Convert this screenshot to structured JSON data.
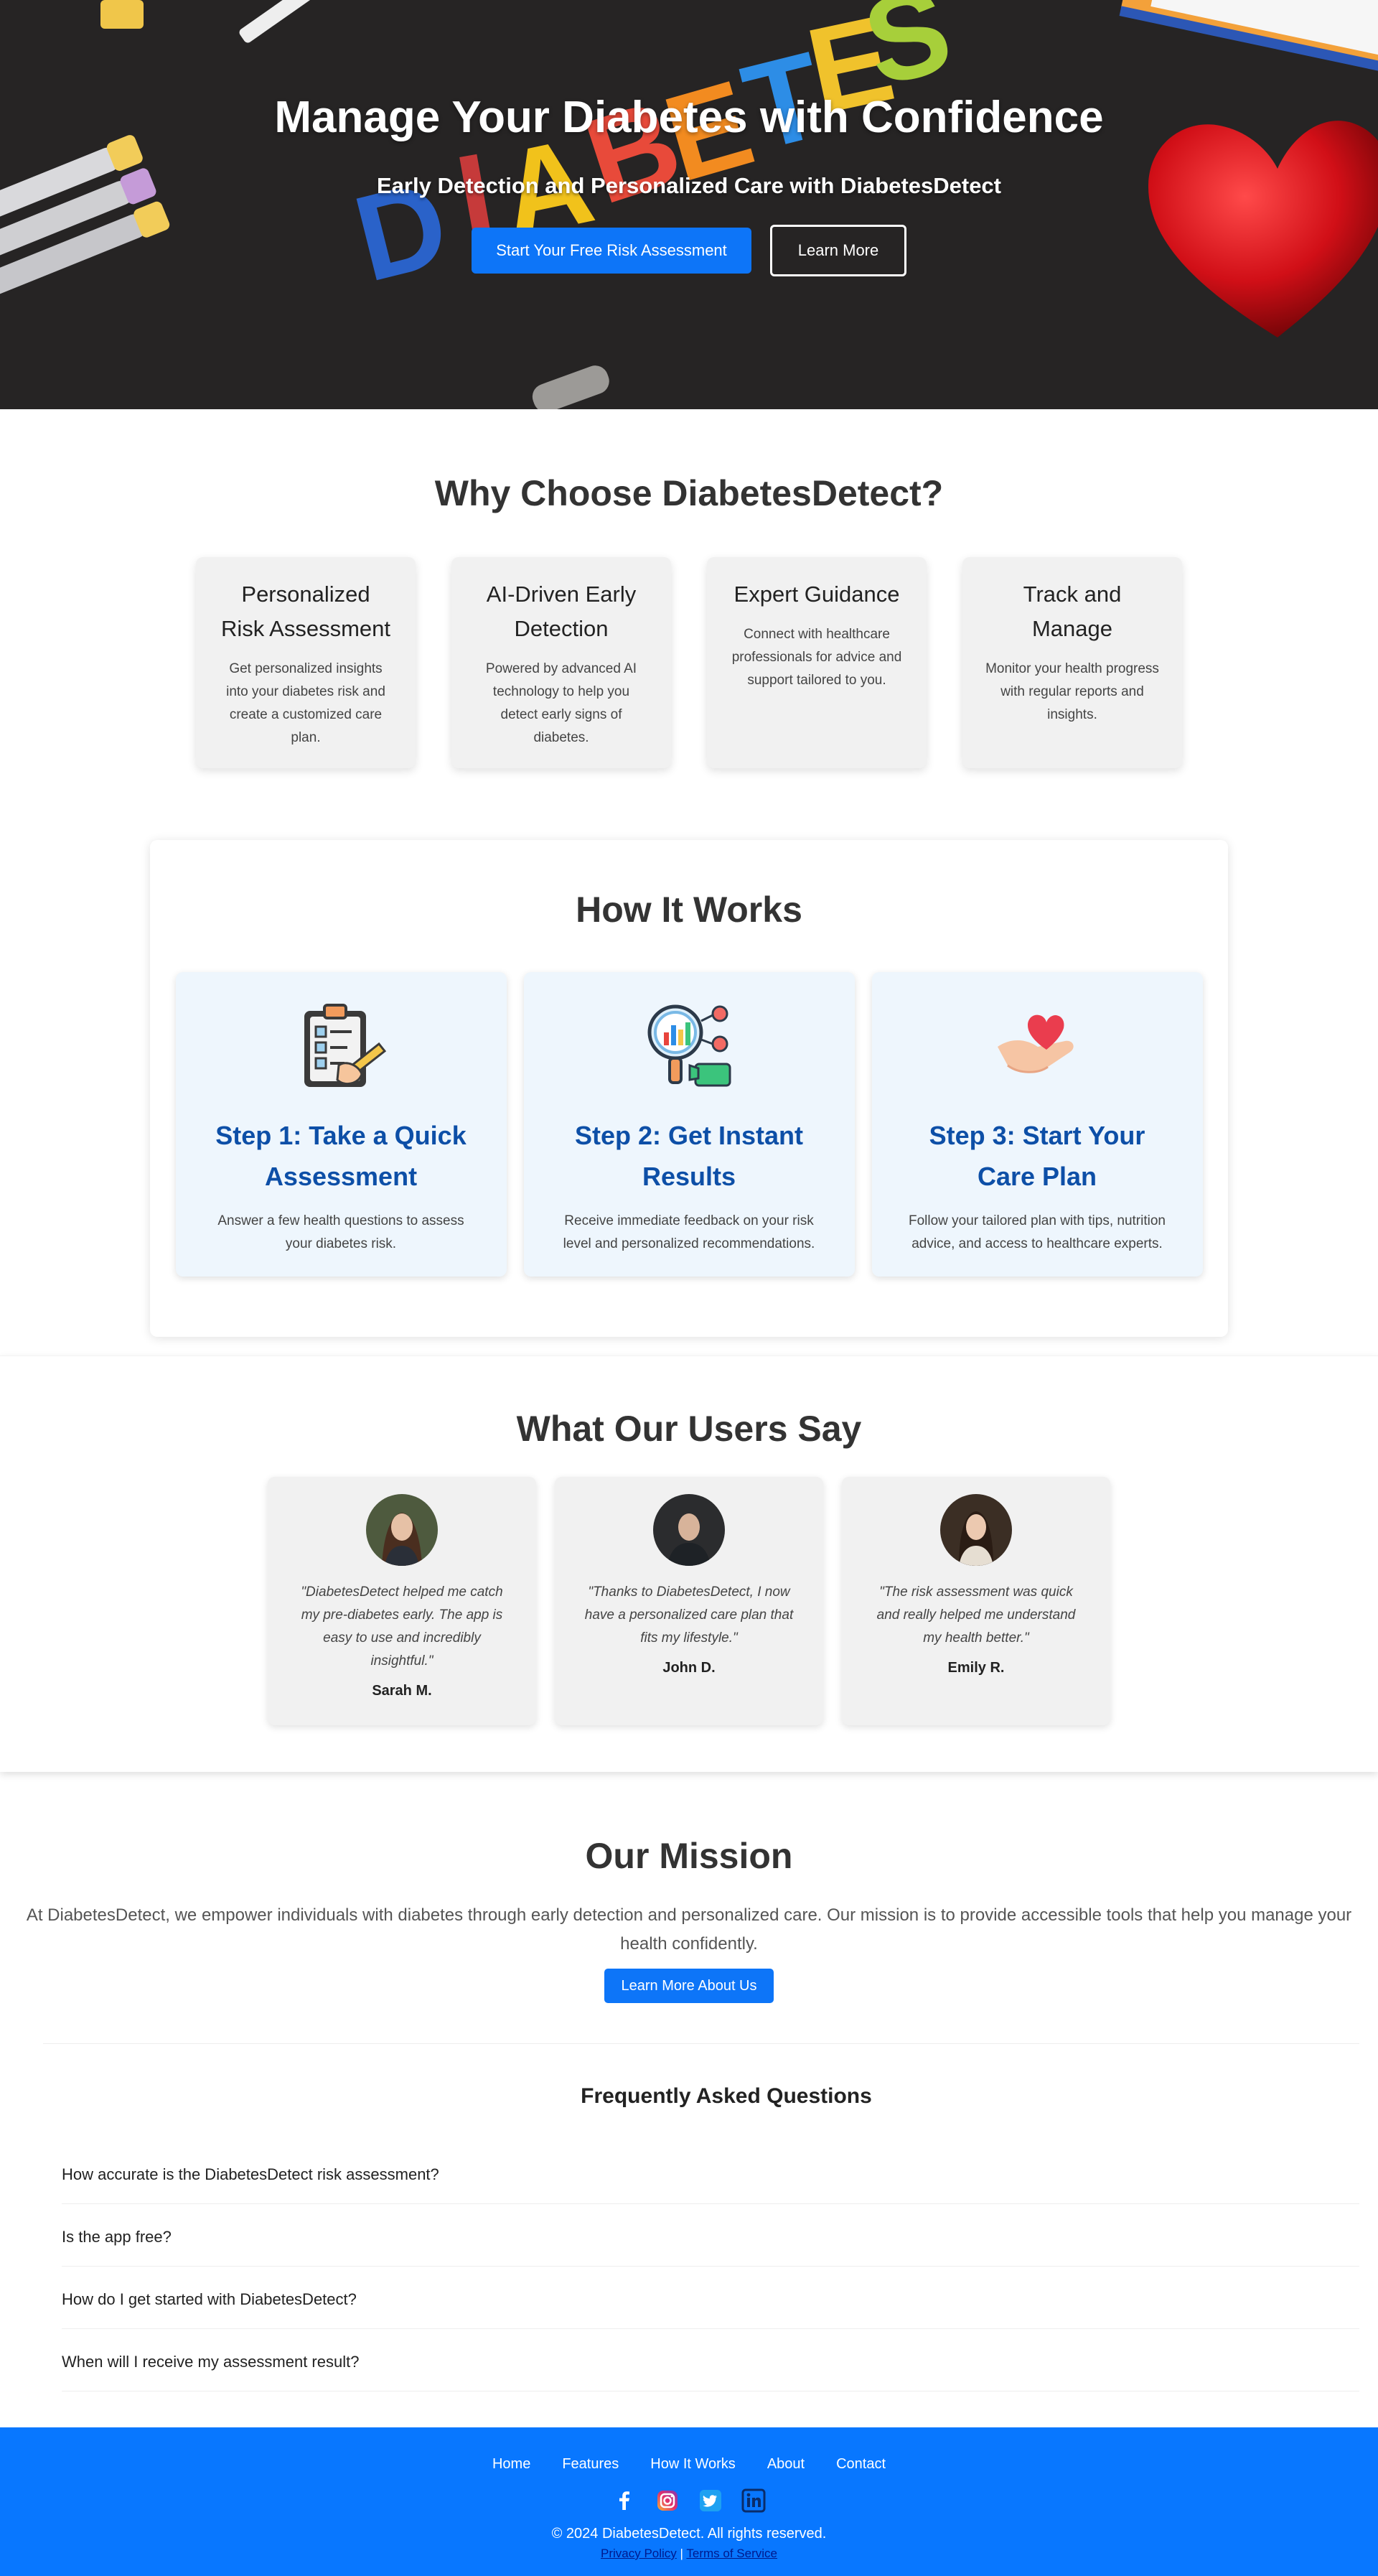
{
  "hero": {
    "title": "Manage Your Diabetes with Confidence",
    "subtitle": "Early Detection and Personalized Care with DiabetesDetect",
    "primary_cta": "Start Your Free Risk Assessment",
    "secondary_cta": "Learn More",
    "background_letters": "DIABETES"
  },
  "why": {
    "heading": "Why Choose DiabetesDetect?",
    "cards": [
      {
        "title": "Personalized Risk Assessment",
        "text": "Get personalized insights into your diabetes risk and create a customized care plan."
      },
      {
        "title": "AI-Driven Early Detection",
        "text": "Powered by advanced AI technology to help you detect early signs of diabetes."
      },
      {
        "title": "Expert Guidance",
        "text": "Connect with healthcare professionals for advice and support tailored to you."
      },
      {
        "title": "Track and Manage",
        "text": "Monitor your health progress with regular reports and insights."
      }
    ]
  },
  "how": {
    "heading": "How It Works",
    "steps": [
      {
        "title": "Step 1: Take a Quick Assessment",
        "text": "Answer a few health questions to assess your diabetes risk.",
        "icon": "clipboard-checklist-icon"
      },
      {
        "title": "Step 2: Get Instant Results",
        "text": "Receive immediate feedback on your risk level and personalized recommendations.",
        "icon": "magnifier-chart-icon"
      },
      {
        "title": "Step 3: Start Your Care Plan",
        "text": "Follow your tailored plan with tips, nutrition advice, and access to healthcare experts.",
        "icon": "hand-heart-icon"
      }
    ]
  },
  "testimonials": {
    "heading": "What Our Users Say",
    "items": [
      {
        "quote": "\"DiabetesDetect helped me catch my pre-diabetes early. The app is easy to use and incredibly insightful.\"",
        "name": "Sarah M."
      },
      {
        "quote": "\"Thanks to DiabetesDetect, I now have a personalized care plan that fits my lifestyle.\"",
        "name": "John D."
      },
      {
        "quote": "\"The risk assessment was quick and really helped me understand my health better.\"",
        "name": "Emily R."
      }
    ]
  },
  "mission": {
    "heading": "Our Mission",
    "text": "At DiabetesDetect, we empower individuals with diabetes through early detection and personalized care. Our mission is to provide accessible tools that help you manage your health confidently.",
    "button": "Learn More About Us"
  },
  "faq": {
    "heading": "Frequently Asked Questions",
    "questions": [
      "How accurate is the DiabetesDetect risk assessment?",
      "Is the app free?",
      "How do I get started with DiabetesDetect?",
      "When will I receive my assessment result?"
    ]
  },
  "footer": {
    "nav": [
      "Home",
      "Features",
      "How It Works",
      "About",
      "Contact"
    ],
    "socials": [
      "facebook-icon",
      "instagram-icon",
      "twitter-icon",
      "linkedin-icon"
    ],
    "copyright": "© 2024 DiabetesDetect. All rights reserved.",
    "privacy": "Privacy Policy",
    "separator": "|",
    "terms": "Terms of Service"
  },
  "colors": {
    "accent": "#0d75f8",
    "footer_bg": "#0877ff",
    "step_title": "#0d4fa7"
  }
}
